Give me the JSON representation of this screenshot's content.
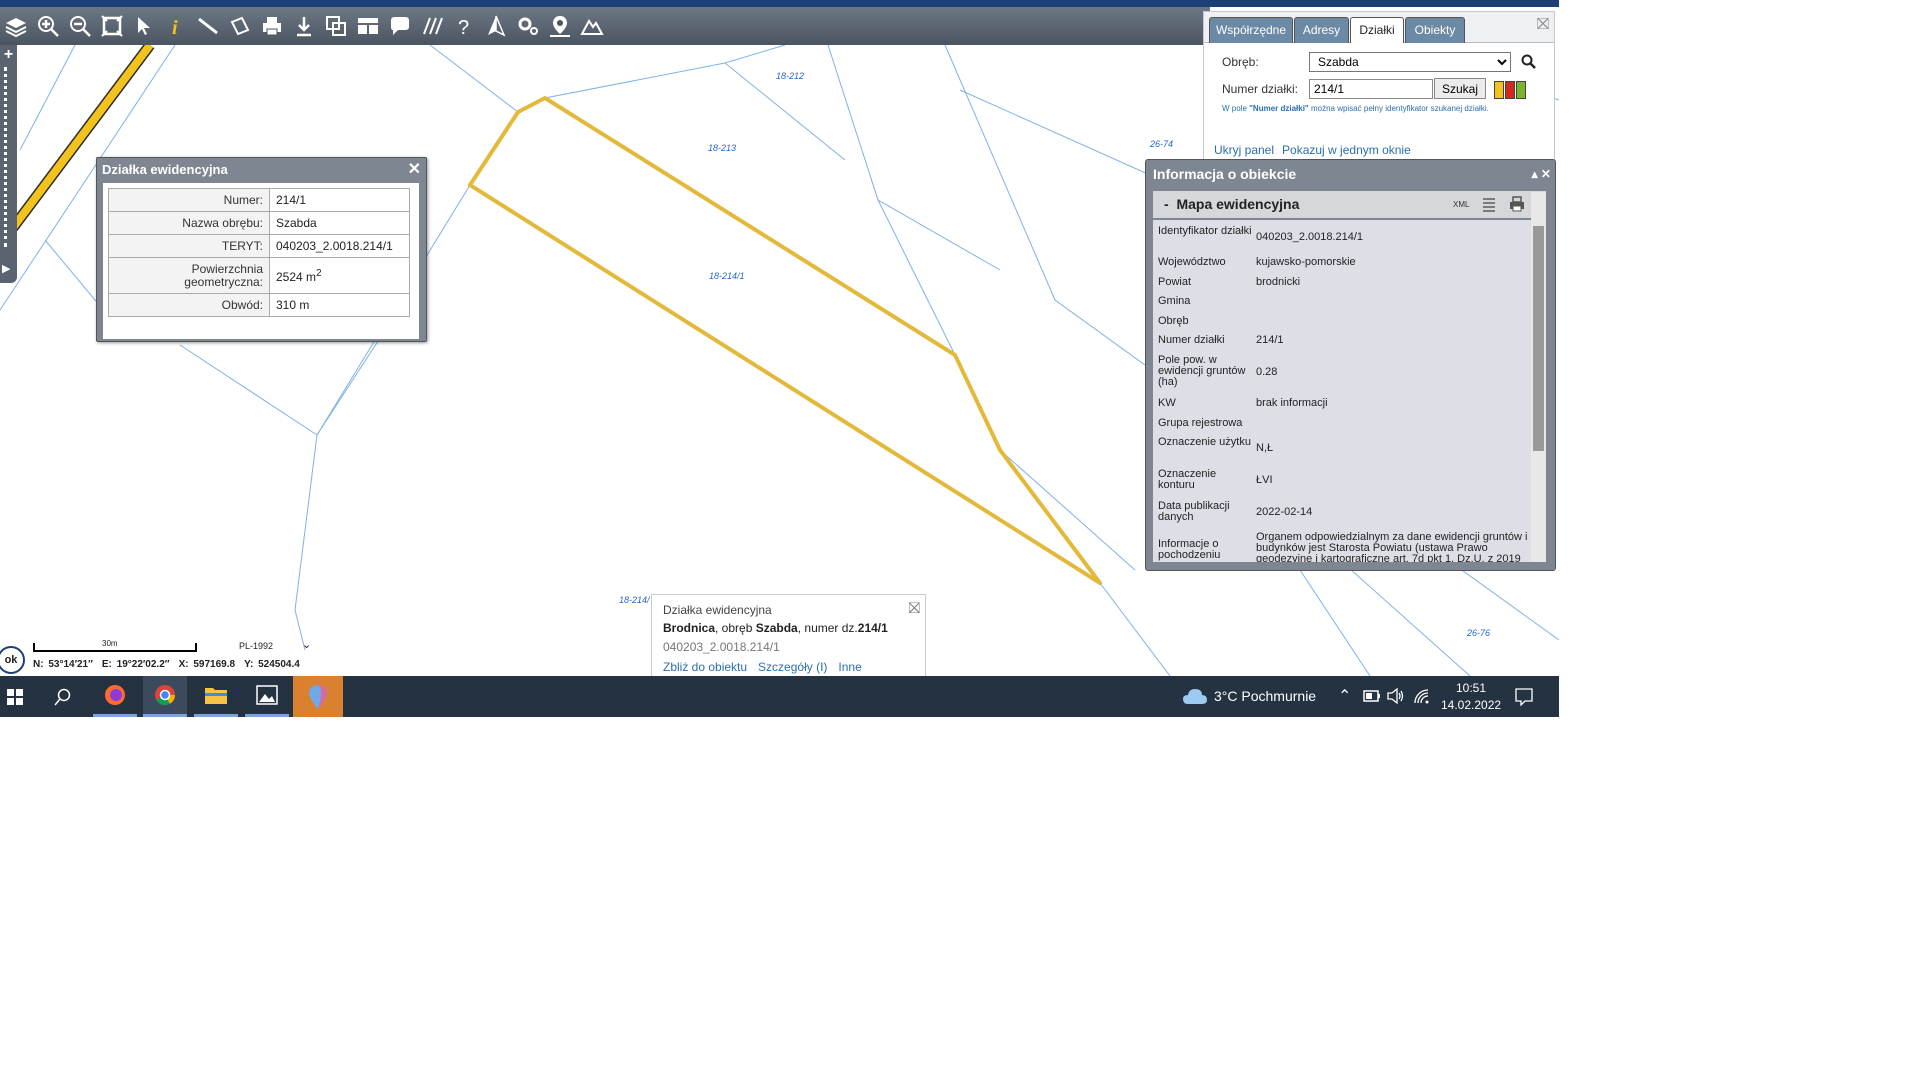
{
  "toolbar": {
    "icons": [
      "layers-icon",
      "zoom-in-icon",
      "zoom-out-icon",
      "zoom-extent-icon",
      "select-arrow-icon",
      "info-icon",
      "measure-distance-icon",
      "measure-area-icon",
      "print-icon",
      "download-icon",
      "copy-icon",
      "layout-icon",
      "comment-icon",
      "hatch-icon",
      "help-icon",
      "north-icon",
      "settings-icon",
      "location-icon",
      "terrain-icon"
    ]
  },
  "map": {
    "parcel_labels": [
      "18-212",
      "18-213",
      "18-214/1",
      "26-74",
      "18-214/",
      "26-76"
    ],
    "highlight_color": "#e2b93b",
    "boundary_color": "#7fb2e5"
  },
  "parcel_popup": {
    "title": "Działka ewidencyjna",
    "close": "✕",
    "rows": [
      {
        "key": "Numer:",
        "value": "214/1"
      },
      {
        "key": "Nazwa obrębu:",
        "value": "Szabda"
      },
      {
        "key": "TERYT:",
        "value": "040203_2.0018.214/1"
      },
      {
        "key": "Powierzchnia geometryczna:",
        "value": "2524 m",
        "sup": "2"
      },
      {
        "key": "Obwód:",
        "value": "310 m"
      }
    ]
  },
  "search_panel": {
    "tabs": [
      "Współrzędne",
      "Adresy",
      "Działki",
      "Obiekty"
    ],
    "active_tab": "Działki",
    "close": "⛝",
    "obreb_label": "Obręb:",
    "obreb_value": "Szabda",
    "numer_label": "Numer działki:",
    "numer_value": "214/1",
    "search_button": "Szukaj",
    "hint_prefix": "W pole ",
    "hint_bold": "\"Numer działki\"",
    "hint_suffix": " można wpisać pełny identyfikator szukanej działki.",
    "link_hide": "Ukryj panel",
    "link_one_window": "Pokazuj w jednym oknie",
    "colors": [
      "#f2c31c",
      "#d7261e",
      "#7ab52b"
    ]
  },
  "info_panel": {
    "title": "Informacja o obiekcie",
    "controls": "▴ ✕",
    "section_toggle": "-",
    "section_title": "Mapa ewidencyjna",
    "xml_label": "XML",
    "rows": [
      {
        "key": "Identyfikator działki",
        "value": "040203_2.0018.214/1"
      },
      {
        "key": "Województwo",
        "value": "kujawsko-pomorskie"
      },
      {
        "key": "Powiat",
        "value": "brodnicki"
      },
      {
        "key": "Gmina",
        "value": ""
      },
      {
        "key": "Obręb",
        "value": ""
      },
      {
        "key": "Numer działki",
        "value": "214/1"
      },
      {
        "key": "Pole pow. w ewidencji gruntów (ha)",
        "value": "0.28"
      },
      {
        "key": "KW",
        "value": "brak informacji"
      },
      {
        "key": "Grupa rejestrowa",
        "value": ""
      },
      {
        "key": "Oznaczenie użytku",
        "value": "N,Ł"
      },
      {
        "key": "Oznaczenie konturu",
        "value": "ŁVI"
      },
      {
        "key": "Data publikacji danych",
        "value": "2022-02-14"
      },
      {
        "key": "Informacje o pochodzeniu",
        "value": "Organem odpowiedzialnym za dane ewidencji gruntów i budynków jest Starosta Powiatu (ustawa Prawo geodezyjne i kartograficzne art. 7d pkt 1, Dz.U. z 2019"
      }
    ]
  },
  "bottom_popup": {
    "title": "Działka ewidencyjna",
    "place": "Brodnica",
    "mid1": ", obręb ",
    "obreb": "Szabda",
    "mid2": ", numer dz.",
    "numer": "214/1",
    "teryt": "040203_2.0018.214/1",
    "link_zoom": "Zbliż do obiektu",
    "link_details": "Szczegóły (I)",
    "link_other": "Inne",
    "close": "⛝"
  },
  "status": {
    "ok": "ok",
    "scale_label": "30m",
    "projection": "PL-1992",
    "chevron": "⌄",
    "n": "N: 53°14′21″",
    "e": "E: 19°22′02.2″",
    "x": "X: 597169.8",
    "y": "Y: 524504.4"
  },
  "taskbar": {
    "apps": [
      "start-icon",
      "search-icon",
      "firefox-icon",
      "chrome-icon",
      "file-explorer-icon",
      "photos-icon",
      "maps-app-icon"
    ],
    "weather": "3°C Pochmurnie",
    "time": "10:51",
    "date": "14.02.2022"
  }
}
